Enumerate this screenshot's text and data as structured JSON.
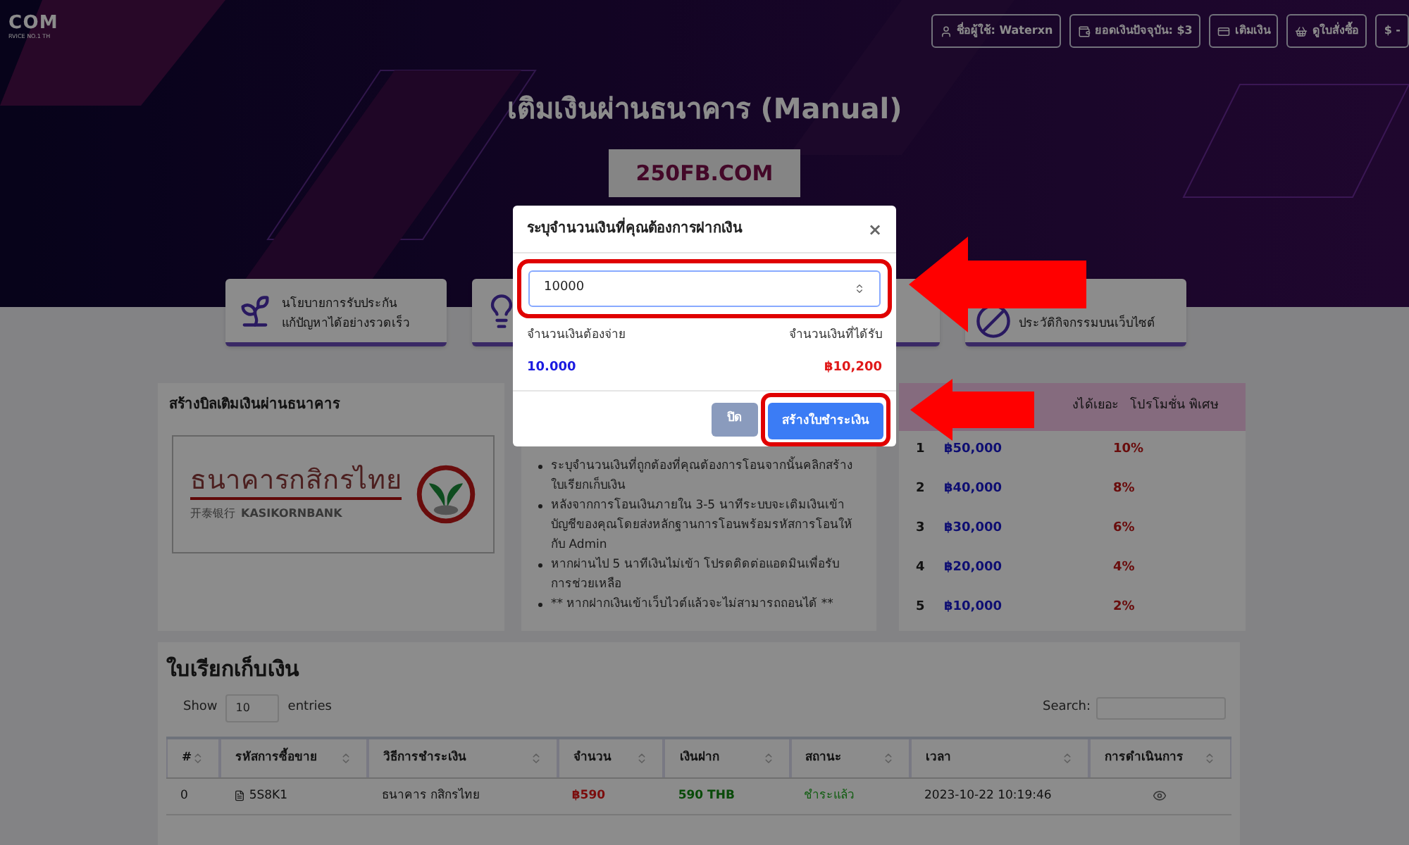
{
  "top_nav": {
    "logo": "COM",
    "logo_tagline": "RVICE NO.1 TH",
    "buttons": [
      "ชื่อผู้ใช้: Waterxn",
      "ยอดเงินปัจจุบัน: $3",
      "เติมเงิน",
      "ดูใบสั่งซื้อ",
      "$ -"
    ]
  },
  "hero": {
    "title": "เติมเงินผ่านธนาคาร (Manual)",
    "badge": "250FB.COM"
  },
  "features": [
    {
      "kind": "text",
      "lines": [
        "นโยบายการรับประกัน",
        "แก้ปัญหาได้อย่างรวดเร็ว"
      ]
    },
    {
      "kind": "bare"
    },
    {
      "kind": "bare"
    },
    {
      "kind": "text",
      "lines": [
        "ประวัติกิจกรรมบนเว็บไซต์"
      ]
    }
  ],
  "bank_card": {
    "title": "สร้างบิลเติมเงินผ่านธนาคาร",
    "logo_thai": "ธนาคารกสิกรไทย",
    "logo_chinese": "开泰银行",
    "logo_english": "KASIKORNBANK"
  },
  "instructions": [
    "ระบุจำนวนเงินที่ถูกต้องที่คุณต้องการโอนจากนั้นคลิกสร้างใบเรียกเก็บเงิน",
    "หลังจากการโอนเงินภายใน 3-5 นาทีระบบจะเติมเงินเข้าบัญชีของคุณโดยส่งหลักฐานการโอนพร้อมรหัสการโอนให้กับ Admin",
    "หากผ่านไป 5 นาทีเงินไม่เข้า โปรดติดต่อแอดมินเพื่อรับการช่วยเหลือ",
    "** หากฝากเงินเข้าเว็บไวต์แล้วจะไม่สามารถถอนได้ **"
  ],
  "promo_table": {
    "columns": [
      "งได้เยอะ",
      "โปรโมชั่น พิเศษ"
    ],
    "rows": [
      {
        "rank": "1",
        "amount": "฿50,000",
        "bonus": "10%"
      },
      {
        "rank": "2",
        "amount": "฿40,000",
        "bonus": "8%"
      },
      {
        "rank": "3",
        "amount": "฿30,000",
        "bonus": "6%"
      },
      {
        "rank": "4",
        "amount": "฿20,000",
        "bonus": "4%"
      },
      {
        "rank": "5",
        "amount": "฿10,000",
        "bonus": "2%"
      }
    ]
  },
  "bills": {
    "title": "ใบเรียกเก็บเงิน",
    "show": "Show",
    "page_size": "10",
    "entries": "entries",
    "search_label": "Search:",
    "columns": [
      "#",
      "รหัสการซื้อขาย",
      "วิธีการชำระเงิน",
      "จำนวน",
      "เงินฝาก",
      "สถานะ",
      "เวลา",
      "การดำเนินการ"
    ],
    "rows": [
      {
        "index": "0",
        "code": "5S8K1",
        "method": "ธนาคาร กสิกรไทย",
        "amount": "฿590",
        "deposit": "590 THB",
        "status": "ชำระแล้ว",
        "time": "2023-10-22 10:19:46"
      }
    ]
  },
  "modal": {
    "title": "ระบุจำนวนเงินที่คุณต้องการฝากเงิน",
    "close": "×",
    "amount_value": "10000",
    "pay_label": "จำนวนเงินต้องจ่าย",
    "receive_label": "จำนวนเงินที่ได้รับ",
    "pay_value": "10.000",
    "receive_value": "฿10,200",
    "cancel_button": "ปิด",
    "submit_button": "สร้างใบชำระเงิน"
  }
}
